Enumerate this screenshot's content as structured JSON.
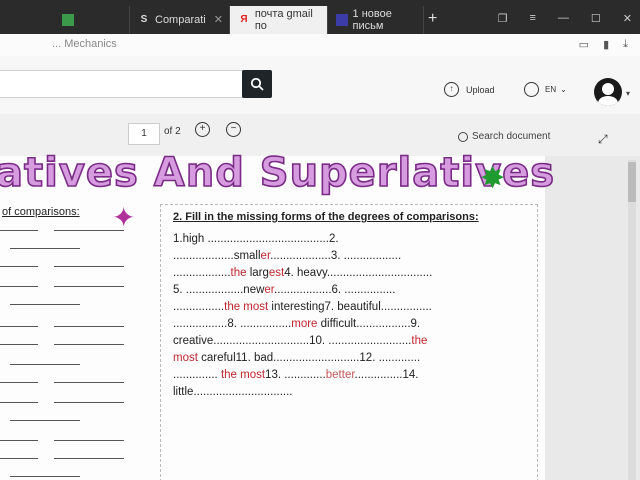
{
  "browser": {
    "tabs": [
      {
        "label": "",
        "icon": "green-tab-icon"
      },
      {
        "label": "Comparati",
        "icon": "S"
      },
      {
        "label": "почта gmail по",
        "icon": "Я"
      },
      {
        "label": "1 новое письм",
        "icon": "▪"
      }
    ],
    "new_tab": "+"
  },
  "site": {
    "name": "... Mechanics"
  },
  "toolbar": {
    "upload_label": "Upload",
    "lang_label": "EN"
  },
  "viewer": {
    "page_number": "1",
    "page_of": "of 2",
    "zoom_in": "+",
    "zoom_out": "−",
    "search_label": "Search document"
  },
  "document": {
    "title": "atives And Superlatives",
    "left_heading": "of comparisons:",
    "task_heading": "2. Fill in the missing forms of the degrees of comparisons:",
    "lines": [
      {
        "parts": [
          {
            "t": "1.high ......................................2."
          }
        ]
      },
      {
        "parts": [
          {
            "t": "...................small"
          },
          {
            "t": "er",
            "c": "red"
          },
          {
            "t": "...................3. .................."
          }
        ]
      },
      {
        "parts": [
          {
            "t": ".................."
          },
          {
            "t": "the",
            "c": "red"
          },
          {
            "t": " larg"
          },
          {
            "t": "est",
            "c": "red"
          },
          {
            "t": "4. heavy................................."
          }
        ]
      },
      {
        "parts": [
          {
            "t": "5. ..................new"
          },
          {
            "t": "er",
            "c": "red"
          },
          {
            "t": "..................6. ................"
          }
        ]
      },
      {
        "parts": [
          {
            "t": "................"
          },
          {
            "t": "the most",
            "c": "red"
          },
          {
            "t": " interesting7. beautiful................"
          }
        ]
      },
      {
        "parts": [
          {
            "t": ".................8. ................"
          },
          {
            "t": "more",
            "c": "red"
          },
          {
            "t": " difficult.................9."
          }
        ]
      },
      {
        "parts": [
          {
            "t": "creative..............................10. .........................."
          },
          {
            "t": "the",
            "c": "red"
          }
        ]
      },
      {
        "parts": [
          {
            "t": "most",
            "c": "red"
          },
          {
            "t": " careful11.  bad...........................12. ............."
          }
        ]
      },
      {
        "parts": [
          {
            "t": ".............. "
          },
          {
            "t": "the most",
            "c": "red"
          },
          {
            "t": "13. ............."
          },
          {
            "t": "better",
            "c": "redlite"
          },
          {
            "t": "...............14."
          }
        ]
      },
      {
        "parts": [
          {
            "t": "little..............................."
          }
        ]
      }
    ]
  }
}
